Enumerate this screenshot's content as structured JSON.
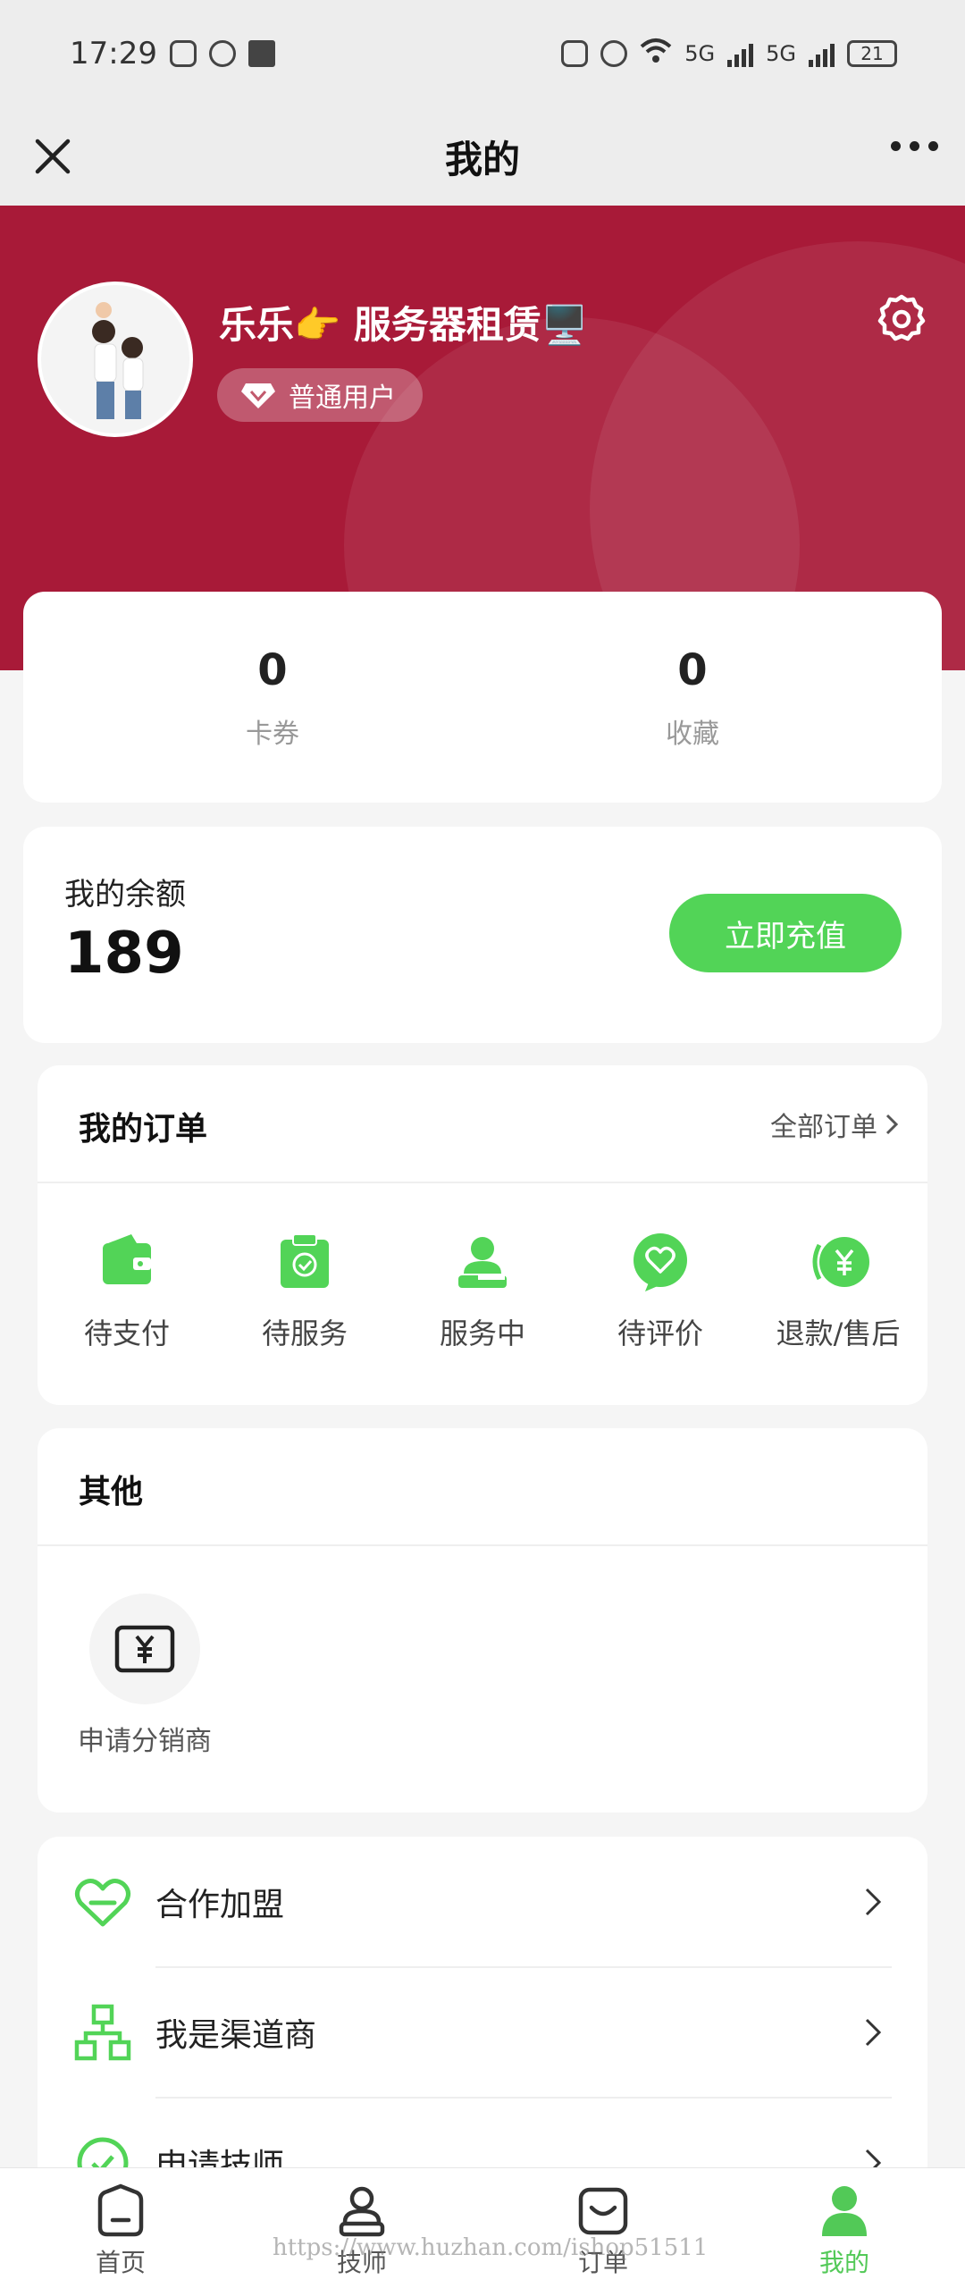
{
  "status_bar": {
    "time": "17:29",
    "battery": "21",
    "net1": "5G",
    "net2": "5G"
  },
  "navbar": {
    "title": "我的"
  },
  "profile": {
    "name": "乐乐👉 服务器租赁🖥️",
    "level": "普通用户"
  },
  "stats": [
    {
      "value": "0",
      "label": "卡券"
    },
    {
      "value": "0",
      "label": "收藏"
    }
  ],
  "balance": {
    "label": "我的余额",
    "value": "189",
    "button": "立即充值"
  },
  "orders": {
    "title": "我的订单",
    "all_label": "全部订单",
    "items": [
      {
        "label": "待支付",
        "icon": "wallet-icon"
      },
      {
        "label": "待服务",
        "icon": "clipboard-check-icon"
      },
      {
        "label": "服务中",
        "icon": "person-service-icon"
      },
      {
        "label": "待评价",
        "icon": "heart-chat-icon"
      },
      {
        "label": "退款/售后",
        "icon": "refund-icon"
      }
    ]
  },
  "others": {
    "title": "其他",
    "items": [
      {
        "label": "申请分销商",
        "icon": "yuan-box-icon"
      }
    ]
  },
  "menu": [
    {
      "label": "合作加盟",
      "icon": "heart-icon"
    },
    {
      "label": "我是渠道商",
      "icon": "org-chart-icon"
    },
    {
      "label": "申请技师",
      "icon": "check-circle-icon"
    }
  ],
  "tabbar": [
    {
      "label": "首页",
      "icon": "home-icon"
    },
    {
      "label": "技师",
      "icon": "technician-icon"
    },
    {
      "label": "订单",
      "icon": "order-bag-icon"
    },
    {
      "label": "我的",
      "icon": "user-icon",
      "active": true
    }
  ],
  "watermark": "https://www.huzhan.com/ishop51511",
  "colors": {
    "brand_red": "#a81a38",
    "accent_green": "#52d457",
    "background": "#f5f5f5"
  }
}
